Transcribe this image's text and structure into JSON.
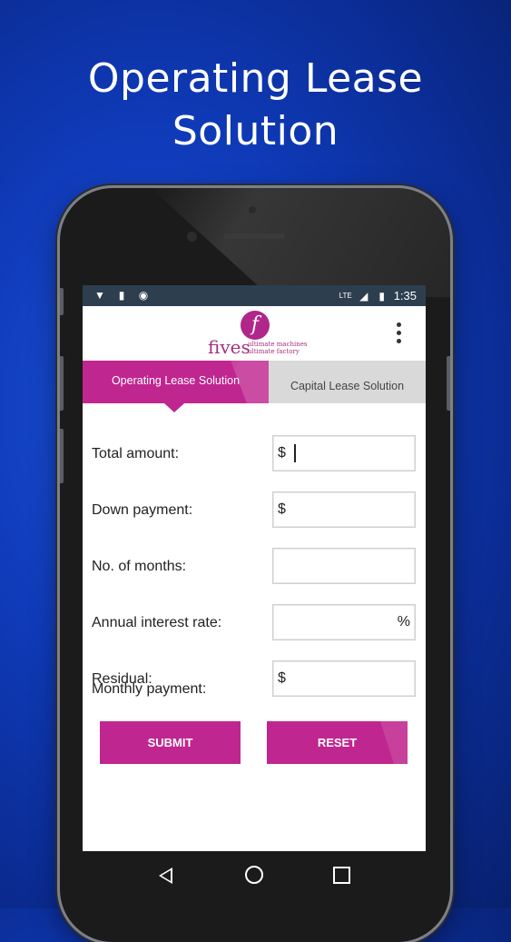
{
  "headline": {
    "line1": "Operating Lease",
    "line2": "Solution"
  },
  "statusbar": {
    "network": "LTE",
    "time": "1:35"
  },
  "app": {
    "logo": {
      "letter": "f",
      "word": "fives",
      "tagline1": "ultimate machines",
      "tagline2": "ultimate factory"
    }
  },
  "tabs": [
    {
      "label": "Operating Lease Solution",
      "active": true
    },
    {
      "label": "Capital Lease Solution",
      "active": false
    }
  ],
  "form": {
    "fields": [
      {
        "label": "Total amount:",
        "prefix": "$",
        "suffix": "",
        "value": ""
      },
      {
        "label": "Down payment:",
        "prefix": "$",
        "suffix": "",
        "value": ""
      },
      {
        "label": "No. of months:",
        "prefix": "",
        "suffix": "",
        "value": ""
      },
      {
        "label": "Annual interest rate:",
        "prefix": "",
        "suffix": "%",
        "value": ""
      },
      {
        "label": "Residual:",
        "prefix": "$",
        "suffix": "",
        "value": ""
      }
    ],
    "submit_label": "SUBMIT",
    "reset_label": "RESET",
    "result_label": "Monthly payment:"
  },
  "colors": {
    "accent": "#c0268f",
    "background": "#0f3ab8",
    "statusbar": "#2d3e4f"
  }
}
